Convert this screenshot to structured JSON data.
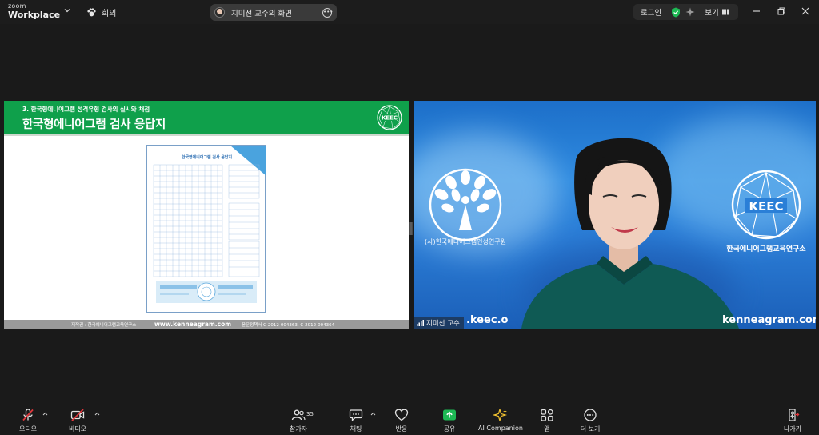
{
  "app": {
    "brand_small": "zoom",
    "brand_big": "Workplace",
    "meeting_label": "회의"
  },
  "share_pill": {
    "text": "지미선 교수의 화면"
  },
  "top_right": {
    "login": "로그인",
    "view": "보기"
  },
  "slide": {
    "subtitle": "3. 한국형에니어그램 성격유형 검사의 실시와 채점",
    "title": "한국형에니어그램 검사 응답지",
    "logo_text": "KEEC",
    "sheet_title": "한국형에니어그램 검사 응답지",
    "footer_author": "저작권 : 한국에니어그램교육연구소",
    "footer_url": "www.kenneagram.com",
    "footer_reg": "윤문정책서 C-2012-004363, C-2012-004364"
  },
  "video": {
    "url_left": ".keec.o",
    "url_right": "kenneagram.com",
    "name_tag": "지미선 교수",
    "tree_logo_text": "(사)한국에니어그램인성연구원",
    "keec_logo_text": "KEEC",
    "keec_ring_text": "한국에니어그램교육연구소"
  },
  "toolbar": {
    "audio": "오디오",
    "video": "비디오",
    "participants": "참가자",
    "participants_count": "35",
    "chat": "채팅",
    "reactions": "반응",
    "share": "공유",
    "ai": "AI Companion",
    "apps": "앱",
    "more": "더 보기",
    "leave": "나가기"
  },
  "colors": {
    "slide_header": "#0fa04b",
    "share_green": "#1db954",
    "mute_red": "#e0363b",
    "ai_gold": "#f2c230"
  }
}
